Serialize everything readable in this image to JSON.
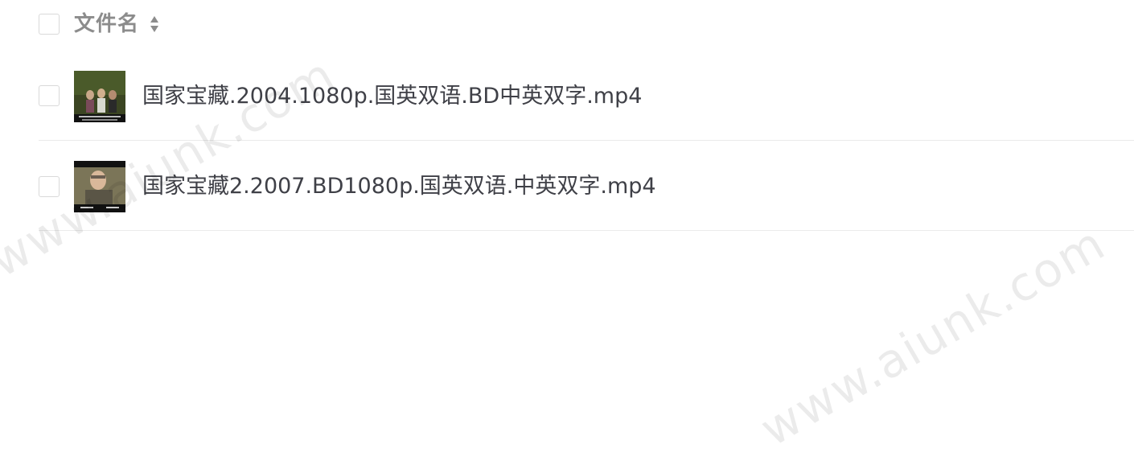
{
  "header": {
    "column_label": "文件名",
    "sort_icon": "sort-icon"
  },
  "files": [
    {
      "name": "国家宝藏.2004.1080p.国英双语.BD中英双字.mp4",
      "thumbnail": "video-thumbnail"
    },
    {
      "name": "国家宝藏2.2007.BD1080p.国英双语.中英双字.mp4",
      "thumbnail": "video-thumbnail"
    }
  ],
  "watermarks": [
    "www.aiunk.com",
    "www.aiunk.com"
  ]
}
